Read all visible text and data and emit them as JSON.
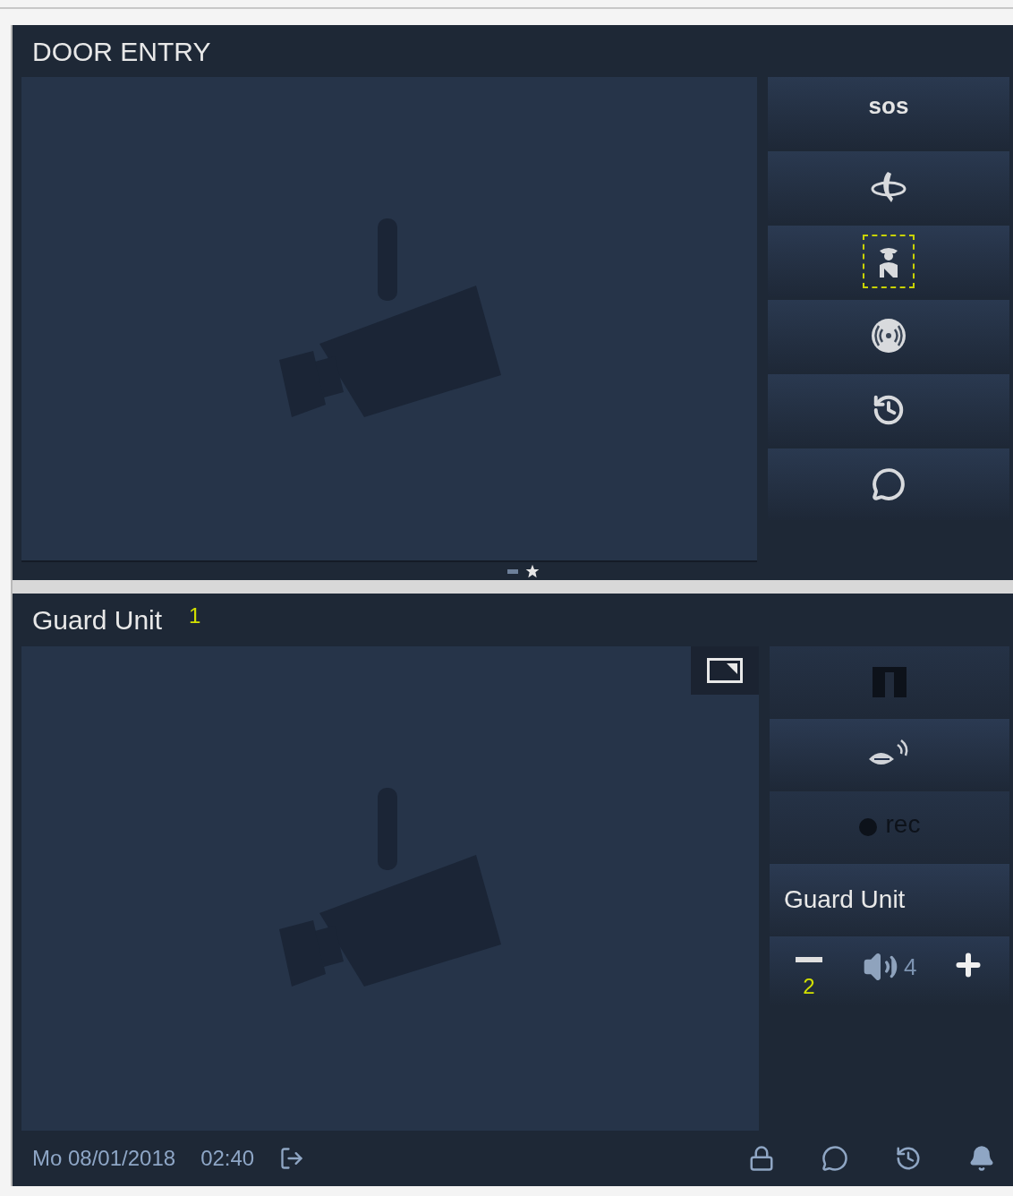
{
  "door_entry": {
    "title": "DOOR ENTRY",
    "buttons": [
      {
        "kind": "sos",
        "label": "sos",
        "focused": false
      },
      {
        "kind": "call",
        "focused": false
      },
      {
        "kind": "guard",
        "focused": true
      },
      {
        "kind": "alarm",
        "focused": false
      },
      {
        "kind": "history",
        "focused": false
      },
      {
        "kind": "message",
        "focused": false
      }
    ],
    "page_indicator": [
      {
        "kind": "dash",
        "selected": false
      },
      {
        "kind": "star",
        "selected": true
      }
    ]
  },
  "call": {
    "title": "Guard Unit",
    "badge": "1",
    "buttons": [
      {
        "kind": "unlock",
        "disabled": true
      },
      {
        "kind": "talk",
        "disabled": false
      },
      {
        "kind": "record",
        "label": "rec",
        "disabled": true
      }
    ],
    "caller": "Guard Unit",
    "volume": {
      "value": "4",
      "hint": "2"
    }
  },
  "status_bar": {
    "date": "Mo 08/01/2018",
    "time": "02:40",
    "icons": [
      {
        "kind": "lock"
      },
      {
        "kind": "message"
      },
      {
        "kind": "history"
      },
      {
        "kind": "bell"
      }
    ]
  }
}
